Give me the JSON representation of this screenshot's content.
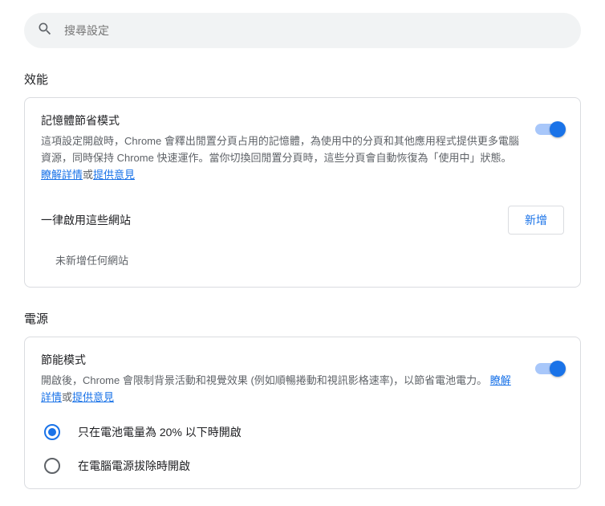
{
  "search": {
    "placeholder": "搜尋設定"
  },
  "performance": {
    "section_title": "效能",
    "memory_saver": {
      "title": "記憶體節省模式",
      "description": "這項設定開啟時，Chrome 會釋出閒置分頁占用的記憶體，為使用中的分頁和其他應用程式提供更多電腦資源，同時保持 Chrome 快速運作。當你切換回閒置分頁時，這些分頁會自動恢復為「使用中」狀態。",
      "learn_more": "瞭解詳情",
      "or_text": "或",
      "feedback": "提供意見",
      "enabled": true
    },
    "always_enable": {
      "label": "一律啟用這些網站",
      "add_button": "新增",
      "empty": "未新增任何網站"
    }
  },
  "power": {
    "section_title": "電源",
    "energy_saver": {
      "title": "節能模式",
      "description": "開啟後，Chrome 會限制背景活動和視覺效果 (例如順暢捲動和視訊影格速率)，以節省電池電力。",
      "learn_more": "瞭解詳情",
      "or_text": "或",
      "feedback": "提供意見",
      "enabled": true,
      "options": [
        {
          "label": "只在電池電量為 20% 以下時開啟",
          "selected": true
        },
        {
          "label": "在電腦電源拔除時開啟",
          "selected": false
        }
      ]
    }
  }
}
